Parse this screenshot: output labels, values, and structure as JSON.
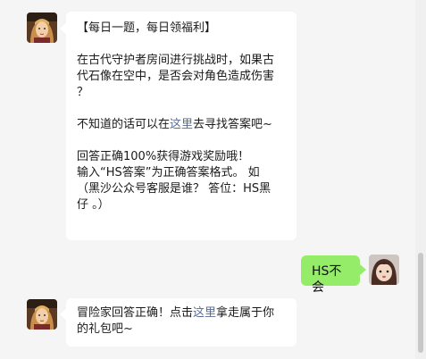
{
  "messages": [
    {
      "side": "left",
      "lines": [
        {
          "text": "【每日一题，每日领福利】"
        },
        {
          "blank": true
        },
        {
          "text": "在古代守护者房间进行挑战时，如果古"
        },
        {
          "text": "代石像在空中，是否会对角色造成伤害"
        },
        {
          "text": "？"
        },
        {
          "blank": true
        },
        {
          "pre": "不知道的话可以在",
          "link": "这里",
          "post": "去寻找答案吧~"
        },
        {
          "blank": true
        },
        {
          "text": "回答正确100%获得游戏奖励哦！"
        },
        {
          "text": "输入“HS答案”为正确答案格式。 如"
        },
        {
          "text": "（黑沙公众号客服是谁？ 答位：HS黑"
        },
        {
          "text": "仔 。）"
        }
      ]
    },
    {
      "side": "right",
      "text": "HS不会"
    },
    {
      "side": "left",
      "lines": [
        {
          "pre": "冒险家回答正确！点击",
          "link": "这里",
          "post": "拿走属于你"
        },
        {
          "text": "的礼包吧~"
        }
      ]
    }
  ],
  "colors": {
    "background": "#f5f5f5",
    "incoming_bubble": "#ffffff",
    "outgoing_bubble": "#95ec69",
    "link": "#576b95"
  }
}
